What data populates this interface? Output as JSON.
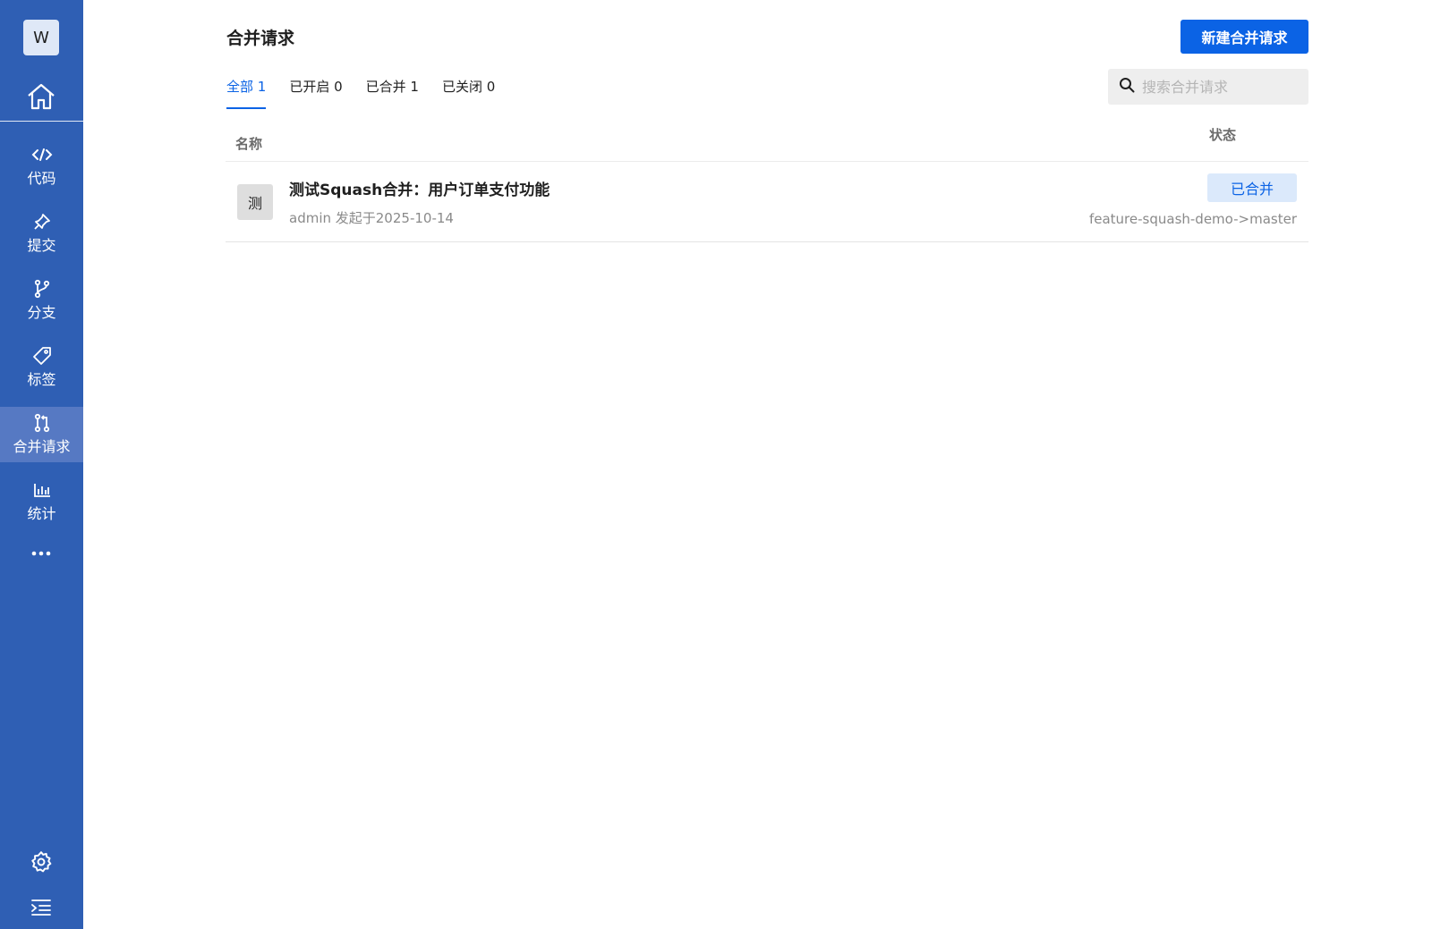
{
  "sidebar": {
    "avatar": "W",
    "items": [
      {
        "label": "代码",
        "icon": "code-icon"
      },
      {
        "label": "提交",
        "icon": "pin-icon"
      },
      {
        "label": "分支",
        "icon": "branch-icon"
      },
      {
        "label": "标签",
        "icon": "tag-icon"
      },
      {
        "label": "合并请求",
        "icon": "merge-request-icon",
        "active": true
      },
      {
        "label": "统计",
        "icon": "bar-chart-icon"
      }
    ],
    "bg_color": "#2f5fb4",
    "active_color": "#5679c3"
  },
  "header": {
    "title": "合并请求",
    "new_button": "新建合并请求"
  },
  "tabs": [
    {
      "label": "全部 1",
      "active": true
    },
    {
      "label": "已开启 0"
    },
    {
      "label": "已合并 1"
    },
    {
      "label": "已关闭 0"
    }
  ],
  "search": {
    "placeholder": "搜索合并请求"
  },
  "table": {
    "col_name": "名称",
    "col_status": "状态",
    "rows": [
      {
        "avatar": "测",
        "title": "测试Squash合并：用户订单支付功能",
        "meta": "admin 发起于2025-10-14",
        "status": "已合并",
        "branch": "feature-squash-demo->master"
      }
    ]
  },
  "colors": {
    "accent": "#0b63e5"
  }
}
